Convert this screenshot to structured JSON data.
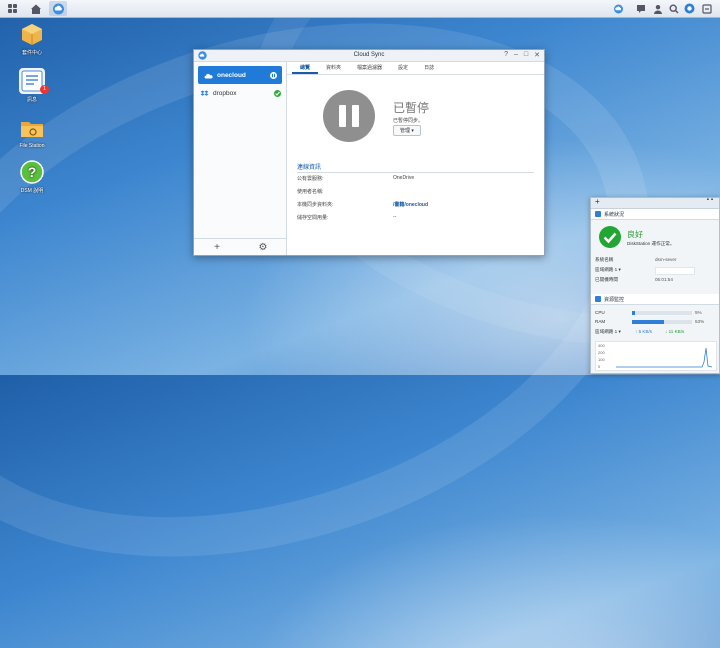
{
  "desktop": {
    "icons": [
      {
        "label": "套件中心",
        "icon": "package-center-icon"
      },
      {
        "label": "訊息",
        "icon": "notes-icon",
        "badge": "1"
      },
      {
        "label": "File Station",
        "icon": "folder-icon"
      },
      {
        "label": "DSM 說明",
        "icon": "help-icon"
      }
    ]
  },
  "window": {
    "title": "Cloud Sync",
    "accounts": [
      {
        "name": "onecloud",
        "status": "paused"
      },
      {
        "name": "dropbox",
        "status": "ok"
      }
    ],
    "tabs": [
      "總覽",
      "資料夾",
      "檔案過濾器",
      "設定",
      "日誌"
    ],
    "status_title": "已暫停",
    "status_sub": "已暫停同步。",
    "manage_label": "管理 ▾",
    "section_title": "連線資訊",
    "info": [
      {
        "key": "公有雲服務:",
        "value": "OneDrive",
        "link": false
      },
      {
        "key": "使用者名稱:",
        "value": "",
        "link": false
      },
      {
        "key": "本機同步資料夾:",
        "value": "/書籍/onecloud",
        "link": true
      },
      {
        "key": "儲存空間用量:",
        "value": "--",
        "link": false
      }
    ]
  },
  "widget": {
    "system": {
      "title": "系統狀況",
      "status_title": "良好",
      "status_sub": "DiskStation 運作正常。",
      "rows": [
        {
          "key": "系統名稱",
          "value": "dsm-sever"
        },
        {
          "key": "區域網路 1 ▾",
          "value": ""
        },
        {
          "key": "已開機時間",
          "value": "05:01:54"
        }
      ]
    },
    "resource": {
      "title": "資源監控",
      "cpu_label": "CPU",
      "cpu_value": "5%",
      "cpu_pct": 5,
      "ram_label": "RAM",
      "ram_value": "53%",
      "ram_pct": 53,
      "net_label": "區域網路 1 ▾",
      "up": "↑ 5 KB/s",
      "down": "↓ 11 KB/s",
      "chart_ticks": [
        "400",
        "200",
        "100",
        "0"
      ]
    }
  }
}
